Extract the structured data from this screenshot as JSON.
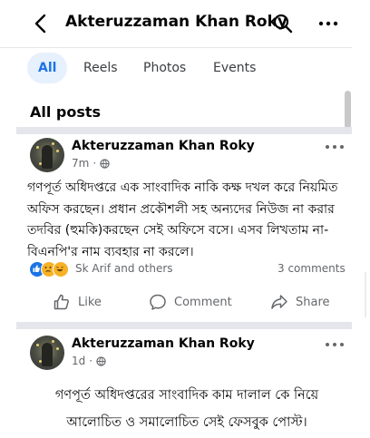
{
  "header": {
    "title": "Akteruzzaman Khan Roky"
  },
  "tabs": [
    {
      "label": "All"
    },
    {
      "label": "Reels"
    },
    {
      "label": "Photos"
    },
    {
      "label": "Events"
    }
  ],
  "section": {
    "title": "All posts"
  },
  "posts": [
    {
      "author": "Akteruzzaman Khan Roky",
      "time": "7m",
      "separator": "·",
      "text": "গণপূর্ত অধিদপ্তরে এক সাংবাদিক নাকি কক্ষ দখল করে নিয়মিত অফিস করছেন। প্রধান প্রকৌশলী সহ অন্যদের নিউজ না করার তদবির (হুমকি)করছেন সেই অফিসে বসে। এসব লিখতাম না- বিএনপি'র নাম ব্যবহার না করলে।",
      "reactions_text": "Sk Arif and others",
      "comments_text": "3 comments",
      "actions": {
        "like": "Like",
        "comment": "Comment",
        "share": "Share"
      }
    },
    {
      "author": "Akteruzzaman Khan Roky",
      "time": "1d",
      "separator": "·",
      "text": "গণপূর্ত অধিদপ্তরের সাংবাদিক কাম দালাল কে নিয়ে আলোচিত ও সমালোচিত সেই ফেসবুক পোস্ট।"
    }
  ],
  "colors": {
    "accent": "#1b74e4",
    "muted": "#65676b",
    "divider": "#e4e6eb"
  },
  "icons": {
    "back": "back-arrow-icon",
    "search": "search-icon",
    "more": "more-dots-icon",
    "globe": "globe-icon",
    "like": "like-thumb-icon",
    "comment": "comment-bubble-icon",
    "share": "share-arrow-icon"
  }
}
